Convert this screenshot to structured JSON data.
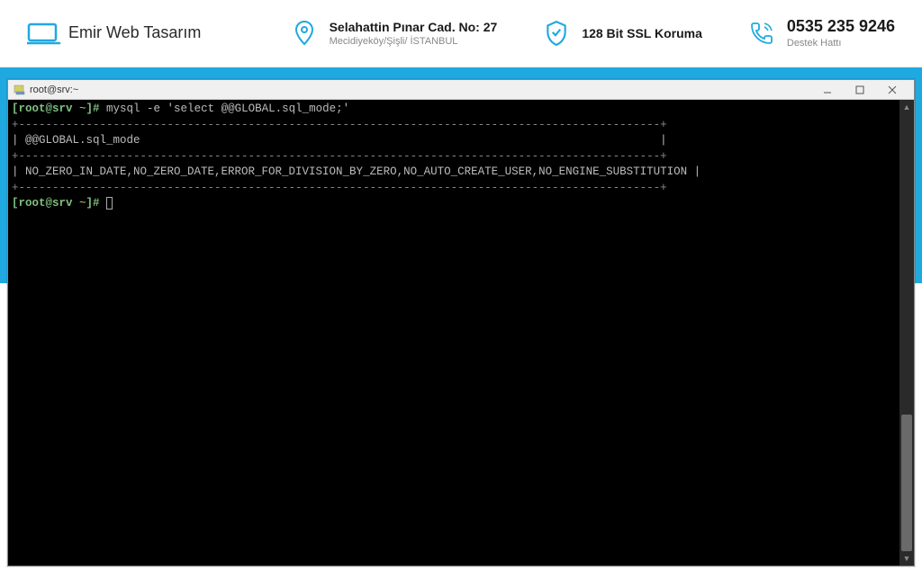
{
  "header": {
    "logo_text": "Emir Web Tasarım",
    "address": {
      "title": "Selahattin Pınar Cad. No: 27",
      "subtitle": "Mecidiyeköy/Şişli/ İSTANBUL"
    },
    "ssl": {
      "title": "128 Bit SSL Koruma"
    },
    "phone": {
      "title": "0535 235 9246",
      "subtitle": "Destek Hattı"
    }
  },
  "terminal": {
    "window_title": "root@srv:~",
    "prompt_user": "[root@srv ",
    "prompt_path": "~",
    "prompt_end": "]# ",
    "command": "mysql -e 'select @@GLOBAL.sql_mode;'",
    "border_line": "+-----------------------------------------------------------------------------------------------+",
    "header_row": "| @@GLOBAL.sql_mode                                                                             |",
    "data_row": "| NO_ZERO_IN_DATE,NO_ZERO_DATE,ERROR_FOR_DIVISION_BY_ZERO,NO_AUTO_CREATE_USER,NO_ENGINE_SUBSTITUTION |"
  },
  "colors": {
    "accent_blue": "#1fa9e0"
  }
}
